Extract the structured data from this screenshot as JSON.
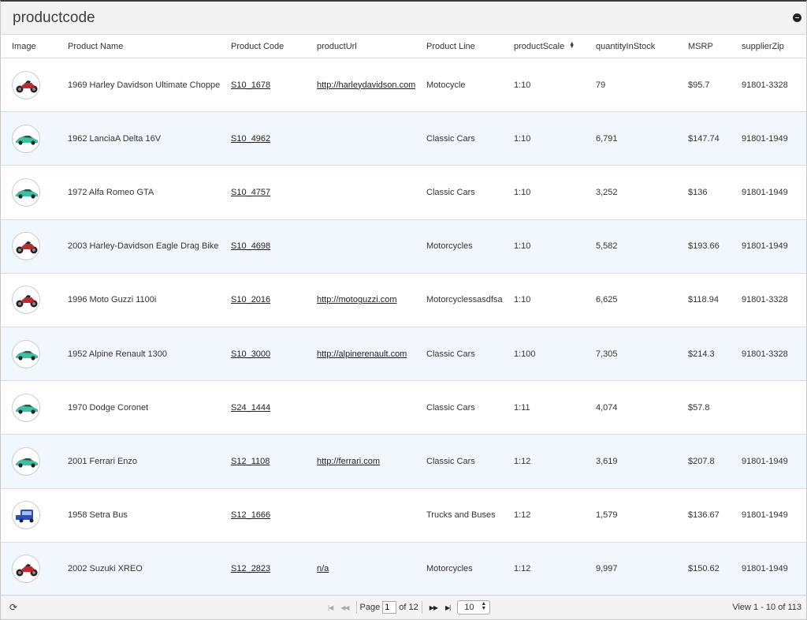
{
  "grid": {
    "title": "productcode",
    "columns": [
      "Image",
      "Product Name",
      "Product Code",
      "productUrl",
      "Product Line",
      "productScale",
      "quantityInStock",
      "MSRP",
      "supplierZip"
    ],
    "rows": [
      {
        "icon": "motorcycle-icon",
        "name": "1969 Harley Davidson Ultimate Chopper",
        "code": "S10_1678",
        "url": "http://harleydavidson.com",
        "line": "Motocycle",
        "scale": "1:10",
        "qty": "79",
        "msrp": "$95.7",
        "zip": "91801-3328"
      },
      {
        "icon": "classic-car-icon",
        "name": "1962 LanciaA Delta 16V",
        "code": "S10_4962",
        "url": "",
        "line": "Classic Cars",
        "scale": "1:10",
        "qty": "6,791",
        "msrp": "$147.74",
        "zip": "91801-1949"
      },
      {
        "icon": "classic-car-icon",
        "name": "1972 Alfa Romeo GTA",
        "code": "S10_4757",
        "url": "",
        "line": "Classic Cars",
        "scale": "1:10",
        "qty": "3,252",
        "msrp": "$136",
        "zip": "91801-1949"
      },
      {
        "icon": "motorcycle-icon",
        "name": "2003 Harley-Davidson Eagle Drag Bike",
        "code": "S10_4698",
        "url": "",
        "line": "Motorcycles",
        "scale": "1:10",
        "qty": "5,582",
        "msrp": "$193.66",
        "zip": "91801-1949"
      },
      {
        "icon": "motorcycle-icon",
        "name": "1996 Moto Guzzi 1100i",
        "code": "S10_2016",
        "url": "http://motoguzzi.com",
        "line": "Motorcyclessasdfsa",
        "scale": "1:10",
        "qty": "6,625",
        "msrp": "$118.94",
        "zip": "91801-3328"
      },
      {
        "icon": "classic-car-icon",
        "name": "1952 Alpine Renault 1300",
        "code": "S10_3000",
        "url": "http://alpinerenault.com",
        "line": "Classic Cars",
        "scale": "1:100",
        "qty": "7,305",
        "msrp": "$214.3",
        "zip": "91801-3328"
      },
      {
        "icon": "classic-car-icon",
        "name": "1970 Dodge Coronet",
        "code": "S24_1444",
        "url": "",
        "line": "Classic Cars",
        "scale": "1:11",
        "qty": "4,074",
        "msrp": "$57.8",
        "zip": ""
      },
      {
        "icon": "classic-car-icon",
        "name": "2001 Ferrari Enzo",
        "code": "S12_1108",
        "url": "http://ferrari.com",
        "line": "Classic Cars",
        "scale": "1:12",
        "qty": "3,619",
        "msrp": "$207.8",
        "zip": "91801-1949"
      },
      {
        "icon": "truck-icon",
        "name": "1958 Setra Bus",
        "code": "S12_1666",
        "url": "",
        "line": "Trucks and Buses",
        "scale": "1:12",
        "qty": "1,579",
        "msrp": "$136.67",
        "zip": "91801-1949"
      },
      {
        "icon": "motorcycle-icon",
        "name": "2002 Suzuki XREO",
        "code": "S12_2823",
        "url": "n/a",
        "line": "Motorcycles",
        "scale": "1:12",
        "qty": "9,997",
        "msrp": "$150.62",
        "zip": "91801-1949"
      }
    ]
  },
  "pager": {
    "page_label": "Page",
    "page_value": "1",
    "of_label": "of 12",
    "rows_per_page": "10",
    "view_info": "View 1 - 10 of 113"
  },
  "colors": {
    "alt_row": "#f2f7fd",
    "car_teal": "#3fbf9f",
    "bike_red": "#c0282e",
    "truck_blue": "#2a50b8"
  }
}
